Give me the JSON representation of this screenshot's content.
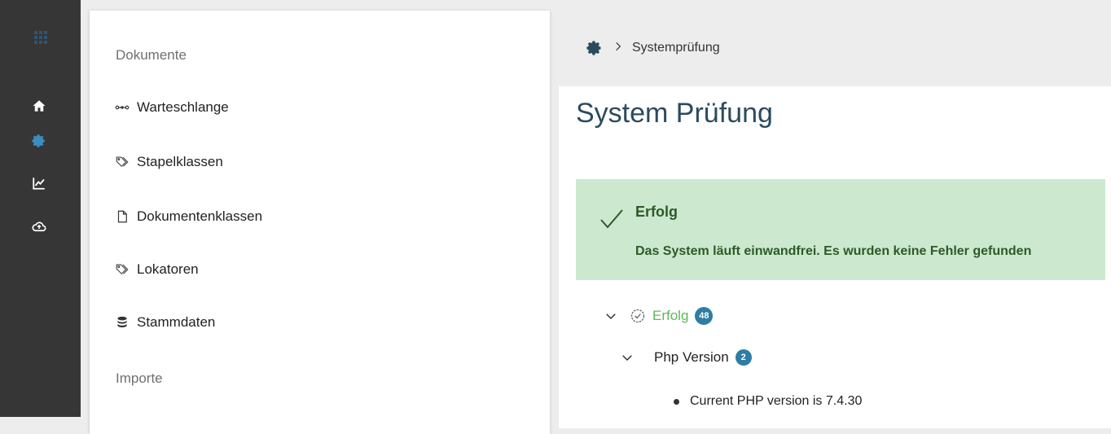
{
  "menu": {
    "sections": {
      "dokumente": "Dokumente",
      "importe": "Importe"
    },
    "items": [
      {
        "icon": "workflow-icon",
        "label": "Warteschlange"
      },
      {
        "icon": "tags-icon",
        "label": "Stapelklassen"
      },
      {
        "icon": "document-icon",
        "label": "Dokumentenklassen"
      },
      {
        "icon": "tags-icon",
        "label": "Lokatoren"
      },
      {
        "icon": "database-icon",
        "label": "Stammdaten"
      }
    ]
  },
  "breadcrumb": {
    "current": "Systemprüfung"
  },
  "page": {
    "title": "System Prüfung"
  },
  "alert": {
    "title": "Erfolg",
    "text": "Das System läuft einwandfrei. Es wurden keine Fehler gefunden",
    "color_bg": "#cce9cf",
    "color_text": "#2d5a27"
  },
  "tree": {
    "root": {
      "label": "Erfolg",
      "count": "48",
      "color": "#5cb85c"
    },
    "child": {
      "label": "Php Version",
      "count": "2"
    },
    "leaf": {
      "text": "Current PHP version is 7.4.30"
    }
  },
  "colors": {
    "rail_bg": "#363636",
    "active_icon": "#3a8ec2",
    "badge": "#2e7da5"
  }
}
